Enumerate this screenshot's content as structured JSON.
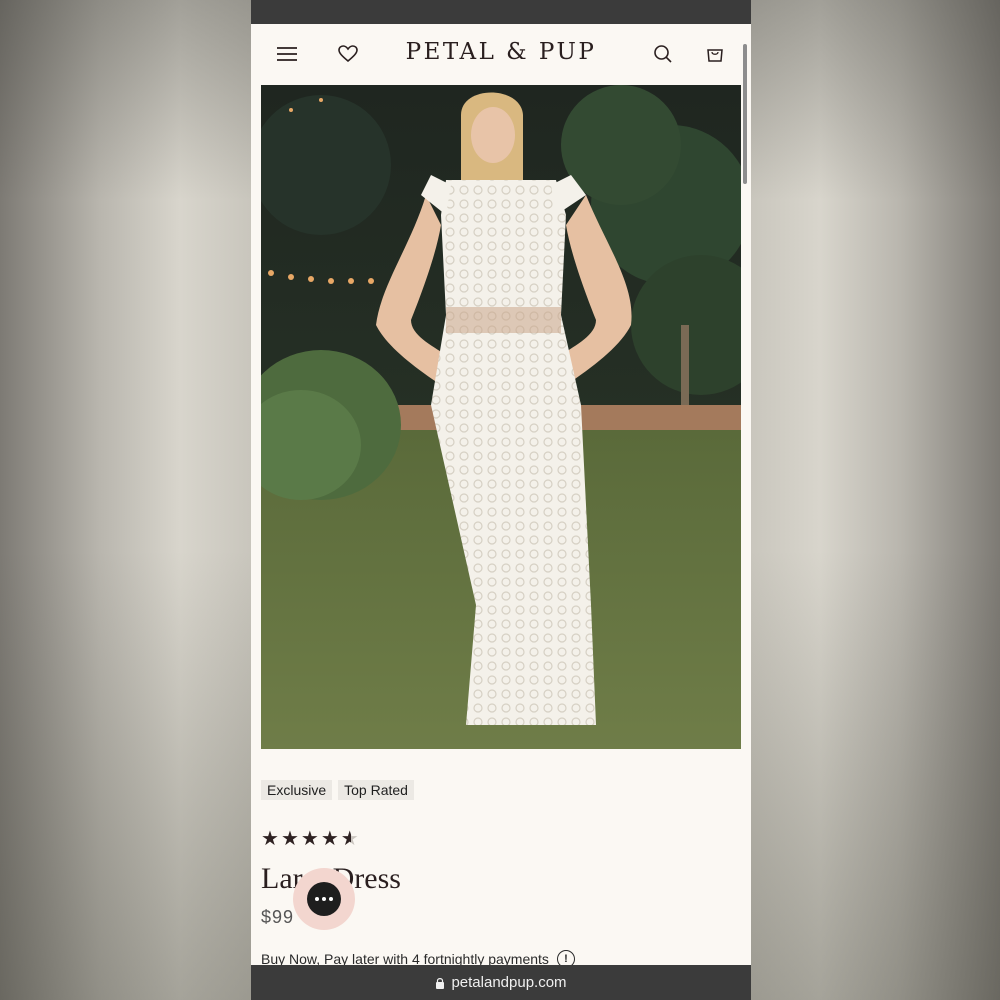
{
  "header": {
    "brand": "PETAL & PUP",
    "icons": [
      "menu-icon",
      "heart-icon",
      "search-icon",
      "bag-icon"
    ]
  },
  "product": {
    "tags": [
      "Exclusive",
      "Top Rated"
    ],
    "rating": 4.5,
    "title": "Lar    Dress",
    "price": "$99",
    "pay_later": "Buy Now, Pay later with 4 fortnightly payments"
  },
  "url_bar": {
    "url": "petalandpup.com"
  },
  "colors": {
    "accent": "#2a1f1f",
    "chat_bubble": "#f3d6cf",
    "page_bg": "#fbf8f3",
    "bar": "#3b3b3b"
  }
}
